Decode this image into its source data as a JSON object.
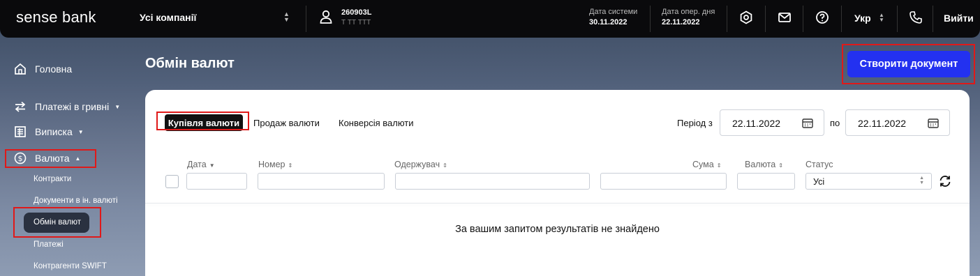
{
  "header": {
    "logo": "sense bank",
    "company": "Усі компанії",
    "user_id": "260903L",
    "user_name": "Т ТТ ТТТ",
    "system_date_label": "Дата системи",
    "system_date": "30.11.2022",
    "oper_date_label": "Дата опер. дня",
    "oper_date": "22.11.2022",
    "language": "Укр",
    "logout": "Вийти"
  },
  "sidebar": {
    "items": [
      {
        "label": "Головна",
        "icon": "home-icon"
      },
      {
        "label": "Платежі в гривні",
        "icon": "transfer-icon"
      },
      {
        "label": "Виписка",
        "icon": "statement-icon"
      },
      {
        "label": "Валюта",
        "icon": "currency-icon"
      }
    ],
    "sub_items": [
      "Контракти",
      "Документи в ін. валюті",
      "Обмін валют",
      "Платежі",
      "Контрагенти SWIFT"
    ]
  },
  "main": {
    "title": "Обмін валют",
    "create_button": "Створити документ",
    "tabs": [
      "Купівля валюти",
      "Продаж валюти",
      "Конверсія валюти"
    ],
    "period_from_label": "Період з",
    "period_from": "22.11.2022",
    "period_to_label": "по",
    "period_to": "22.11.2022",
    "columns": [
      "Дата",
      "Номер",
      "Одержувач",
      "Сума",
      "Валюта",
      "Статус"
    ],
    "status_value": "Усі",
    "empty_message": "За вашим запитом результатів не знайдено"
  },
  "colors": {
    "accent": "#2331f0",
    "highlight_box": "#e01919",
    "topbar": "#0a0a0c"
  }
}
